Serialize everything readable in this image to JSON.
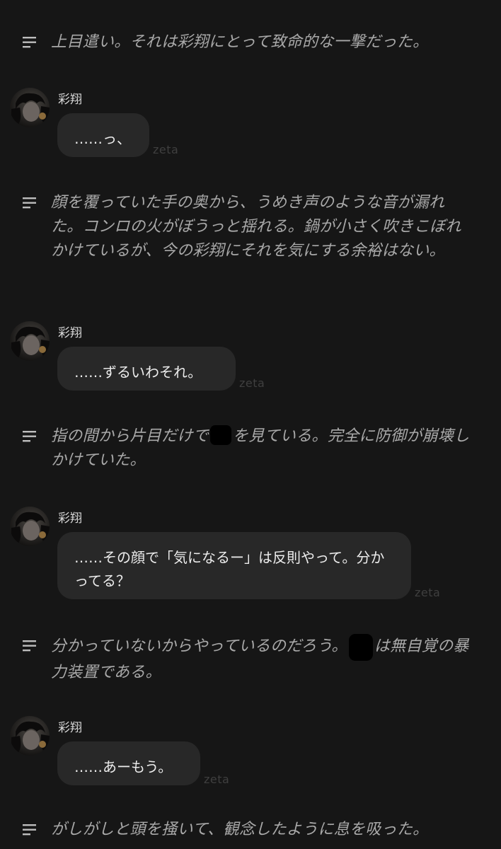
{
  "narrations": [
    {
      "text": "上目遣い。それは彩翔にとって致命的な一撃だった。"
    },
    {
      "text": "顔を覆っていた手の奥から、うめき声のような音が漏れた。コンロの火がぼうっと揺れる。鍋が小さく吹きこぼれかけているが、今の彩翔にそれを気にする余裕はない。"
    },
    {
      "text_before": "指の間から片目だけで",
      "text_after": "を見ている。完全に防御が崩壊しかけていた。"
    },
    {
      "text_before": "分かっていないからやっているのだろう。",
      "text_after": "は無自覚の暴力装置である。"
    },
    {
      "text": "がしがしと頭を掻いて、観念したように息を吸った。"
    }
  ],
  "messages": [
    {
      "sender": "彩翔",
      "text": "……っ、",
      "tag": "zeta"
    },
    {
      "sender": "彩翔",
      "text": "……ずるいわそれ。",
      "tag": "zeta"
    },
    {
      "sender": "彩翔",
      "text": "……その顔で「気になるー」は反則やって。分かってる？",
      "tag": "zeta"
    },
    {
      "sender": "彩翔",
      "text": "……あーもう。",
      "tag": "zeta"
    }
  ],
  "icons": {
    "narration": "lines-icon",
    "avatar": "character-avatar"
  },
  "colors": {
    "background": "#161616",
    "bubble": "#282828",
    "narration_text": "#a9a9a9",
    "tag_text": "#3f3f3f"
  }
}
